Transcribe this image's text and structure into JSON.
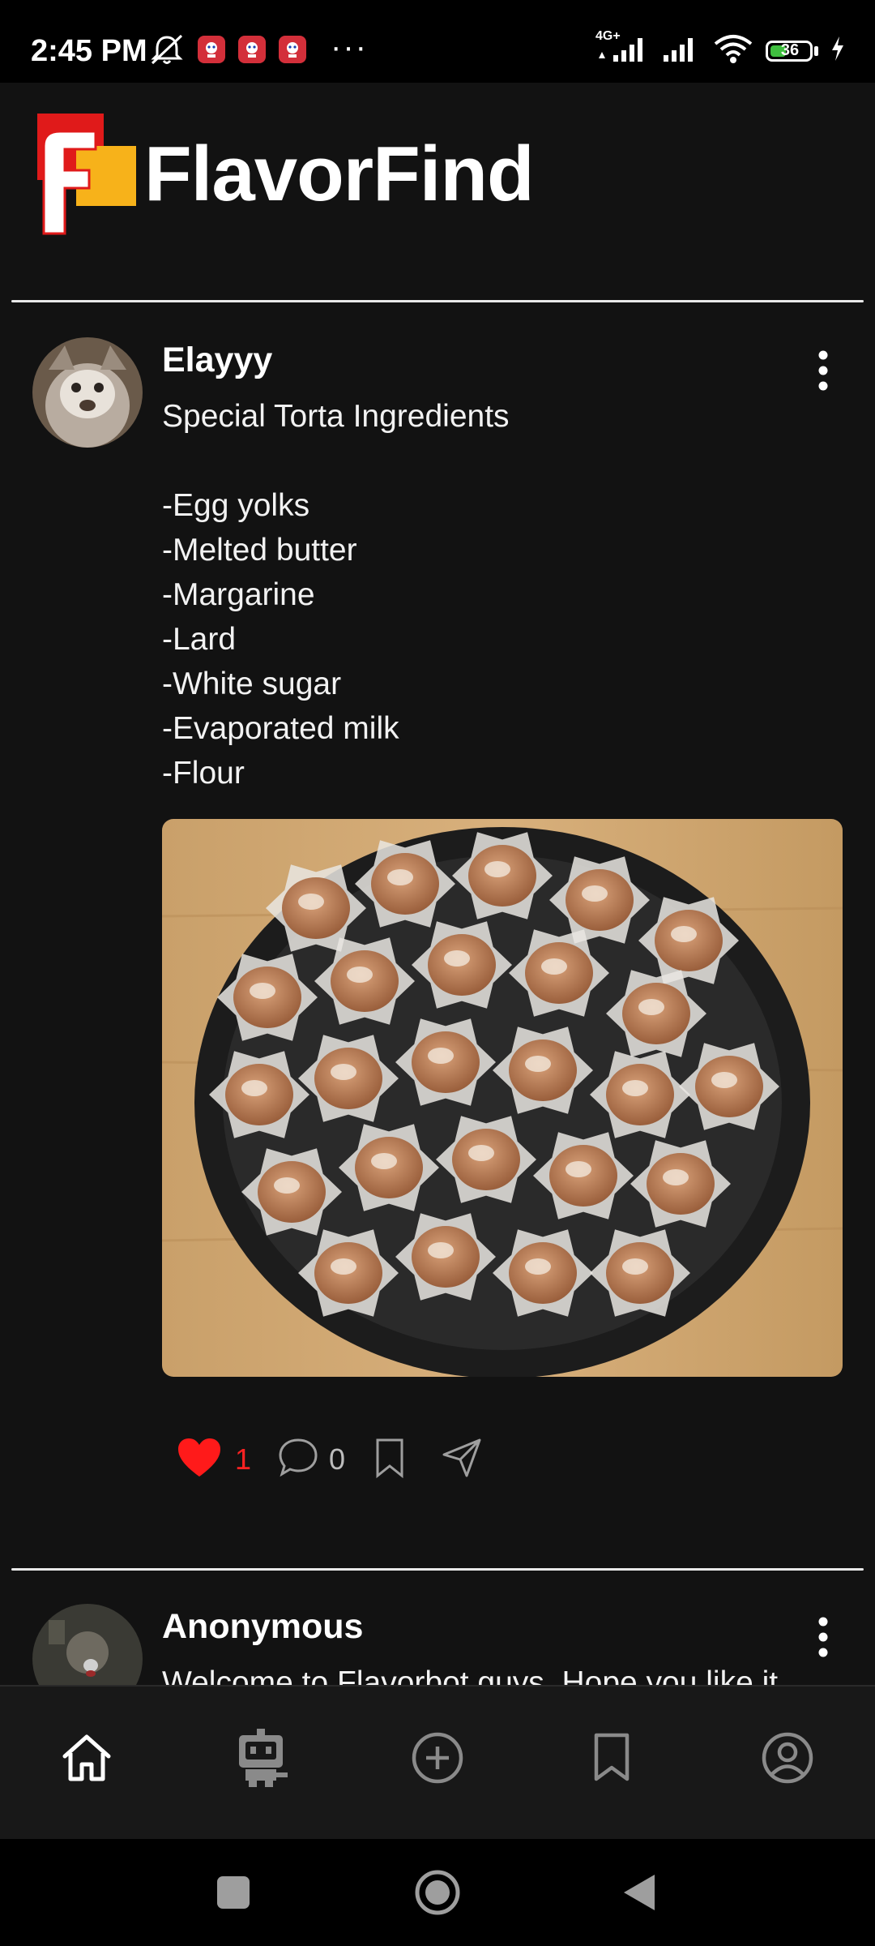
{
  "status_bar": {
    "time": "2:45 PM",
    "network_label": "4G+",
    "battery_level": "36",
    "battery_fraction": 0.36,
    "more": "···"
  },
  "header": {
    "app_name": "FlavorFind",
    "logo_letter": "F",
    "logo_colors": {
      "red": "#e01a1a",
      "yellow": "#f7b21a"
    }
  },
  "posts": [
    {
      "author": "Elayyy",
      "title": "Special Torta Ingredients",
      "ingredients": [
        "-Egg yolks",
        "-Melted butter",
        "-Margarine",
        "-Lard",
        "-White sugar",
        "-Evaporated milk",
        "-Flour"
      ],
      "likes": "1",
      "comments": "0",
      "liked": true
    },
    {
      "author": "Anonymous",
      "preview": "Welcome to Flavorbot guys. Hope you like it"
    }
  ],
  "colors": {
    "background": "#121212",
    "like_red": "#ff2222",
    "divider": "#e8e8e8"
  },
  "bottom_nav": [
    {
      "icon": "home-icon",
      "active": true
    },
    {
      "icon": "robot-icon",
      "active": false
    },
    {
      "icon": "add-post-icon",
      "active": false
    },
    {
      "icon": "bookmark-icon",
      "active": false
    },
    {
      "icon": "profile-icon",
      "active": false
    }
  ],
  "system_nav": [
    "recents-icon",
    "home-circle-icon",
    "back-icon"
  ]
}
